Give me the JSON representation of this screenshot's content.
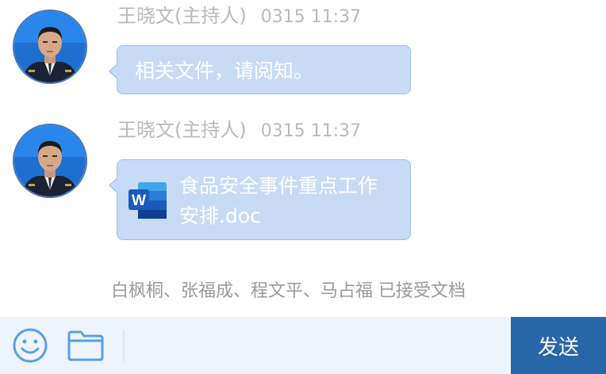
{
  "messages": [
    {
      "sender": "王晓文(主持人)",
      "time": "0315 11:37",
      "text": "相关文件，请阅知。"
    },
    {
      "sender": "王晓文(主持人)",
      "time": "0315 11:37",
      "file": {
        "name": "食品安全事件重点工作安排.doc",
        "icon": "word-doc-icon"
      }
    }
  ],
  "system_note": "白枫桐、张福成、程文平、马占福 已接受文档",
  "input_bar": {
    "placeholder": "",
    "send_label": "发送",
    "icons": [
      "emoji-icon",
      "folder-icon"
    ]
  },
  "colors": {
    "bubble": "#c7dbf6",
    "bubble_border": "#99c2f0",
    "send_button": "#2766a9",
    "input_bar": "#eef4fc"
  }
}
